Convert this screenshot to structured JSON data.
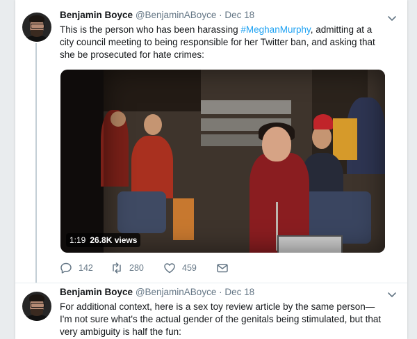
{
  "tweets": [
    {
      "name": "Benjamin Boyce",
      "handle": "@BenjaminABoyce",
      "separator": "·",
      "date": "Dec 18",
      "text_before": "This is the person who has been harassing ",
      "hashtag": "#MeghanMurphy",
      "text_after": ", admitting at a city council meeting to being responsible for her Twitter ban, and asking that she be prosecuted for hate crimes:",
      "video": {
        "duration": "1:19",
        "views": "26.8K views"
      },
      "actions": {
        "replies": "142",
        "retweets": "280",
        "likes": "459"
      }
    },
    {
      "name": "Benjamin Boyce",
      "handle": "@BenjaminABoyce",
      "separator": "·",
      "date": "Dec 18",
      "text": "For additional context, here is a sex toy review article by the same person—I'm not sure what's the actual gender of the genitals being stimulated, but that very ambiguity is half the fun:"
    }
  ],
  "colors": {
    "accent": "#1da1f2",
    "muted": "#657786",
    "text": "#14171a",
    "background": "#e9ecee"
  },
  "icons": [
    "chevron-down-icon",
    "reply-icon",
    "retweet-icon",
    "heart-icon",
    "direct-message-icon"
  ]
}
